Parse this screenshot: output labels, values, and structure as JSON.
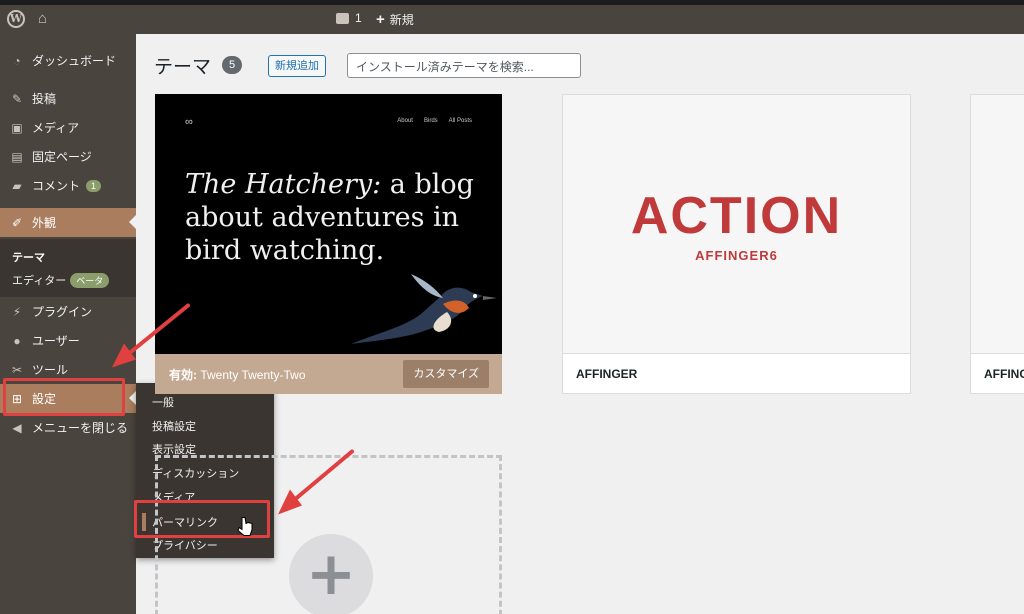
{
  "topbar": {
    "comment_count": "1",
    "new_label": "新規"
  },
  "sidebar": {
    "items": [
      {
        "label": "ダッシュボード",
        "icon": "dashboard-icon"
      },
      {
        "label": "投稿",
        "icon": "pin-icon"
      },
      {
        "label": "メディア",
        "icon": "media-icon"
      },
      {
        "label": "固定ページ",
        "icon": "page-icon"
      },
      {
        "label": "コメント",
        "icon": "comment-icon",
        "badge": "1"
      },
      {
        "label": "外観",
        "icon": "brush-icon"
      },
      {
        "label": "プラグイン",
        "icon": "plugin-icon"
      },
      {
        "label": "ユーザー",
        "icon": "user-icon"
      },
      {
        "label": "ツール",
        "icon": "wrench-icon"
      },
      {
        "label": "設定",
        "icon": "settings-icon"
      },
      {
        "label": "メニューを閉じる",
        "icon": "collapse-icon"
      }
    ],
    "appearance_sub": {
      "themes": "テーマ",
      "editor": "エディター",
      "beta": "ベータ"
    }
  },
  "settings_flyout": [
    "一般",
    "投稿設定",
    "表示設定",
    "ディスカッション",
    "メディア",
    "パーマリンク",
    "プライバシー"
  ],
  "page": {
    "title": "テーマ",
    "count": "5",
    "add_new": "新規追加",
    "search_placeholder": "インストール済みテーマを検索..."
  },
  "themes": [
    {
      "nav": [
        "About",
        "Birds",
        "All Posts"
      ],
      "hero_italic": "The Hatchery:",
      "hero_rest": " a blog about adventures in bird watching.",
      "active_prefix": "有効:",
      "name": "Twenty Twenty-Two",
      "customize": "カスタマイズ"
    },
    {
      "brand": "ACTION",
      "brand_sub": "AFFINGER6",
      "name": "AFFINGER"
    },
    {
      "name": "AFFINGER Child"
    }
  ],
  "colors": {
    "sidebar": "#4a443e",
    "accent": "#a97d5e",
    "highlight": "#e0403f"
  }
}
